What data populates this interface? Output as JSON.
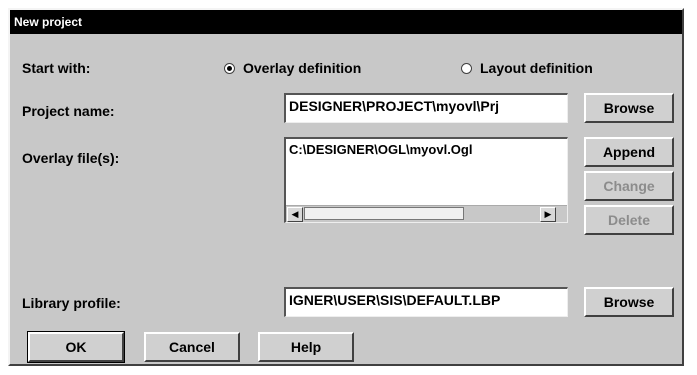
{
  "window": {
    "title": "New project"
  },
  "start_with": {
    "label": "Start with:",
    "options": [
      {
        "label": "Overlay definition",
        "checked": true
      },
      {
        "label": "Layout definition",
        "checked": false
      }
    ]
  },
  "project_name": {
    "label": "Project name:",
    "value": "DESIGNER\\PROJECT\\myovl\\Prj",
    "browse_label": "Browse"
  },
  "overlay_files": {
    "label": "Overlay file(s):",
    "items": [
      "C:\\DESIGNER\\OGL\\myovl.Ogl"
    ],
    "append_label": "Append",
    "change_label": "Change",
    "delete_label": "Delete"
  },
  "library_profile": {
    "label": "Library profile:",
    "value": "IGNER\\USER\\SIS\\DEFAULT.LBP",
    "browse_label": "Browse"
  },
  "footer": {
    "ok_label": "OK",
    "cancel_label": "Cancel",
    "help_label": "Help"
  }
}
